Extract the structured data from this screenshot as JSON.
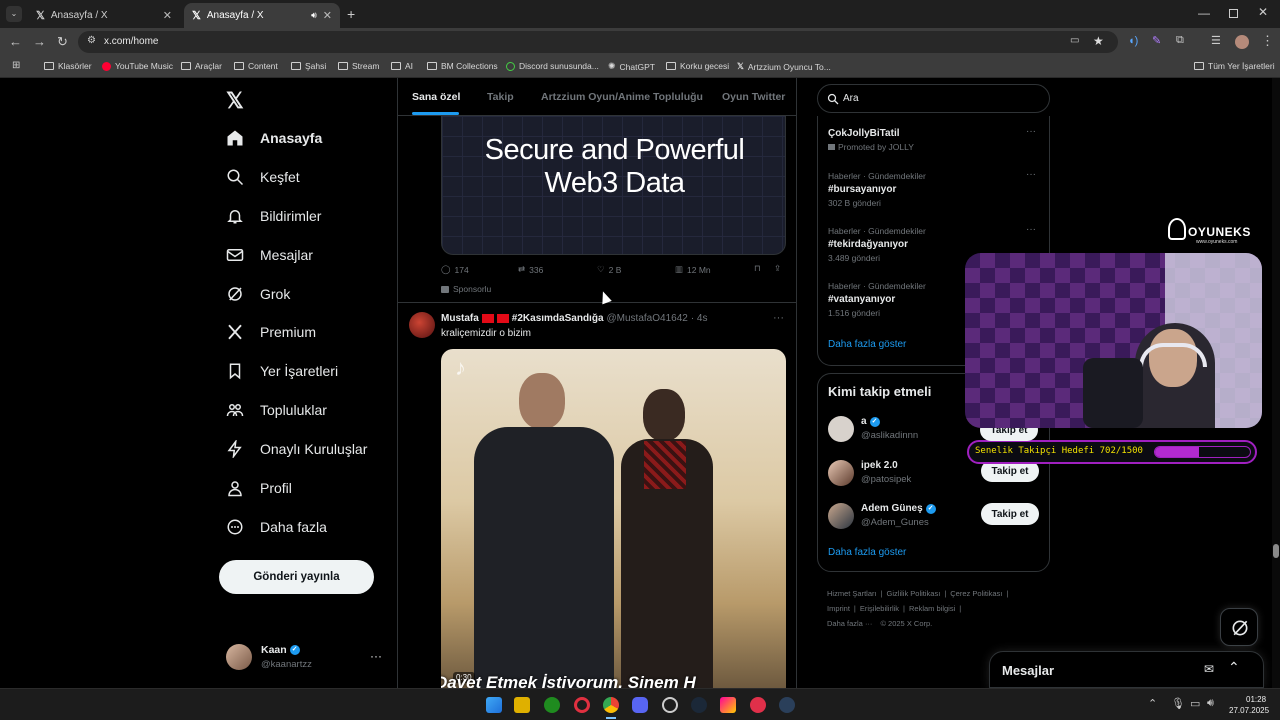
{
  "browser": {
    "tabs": [
      {
        "title": "Anasayfa / X"
      },
      {
        "title": "Anasayfa / X"
      }
    ],
    "url": "x.com/home",
    "bookmarks": [
      "Klasörler",
      "YouTube Music",
      "Araçlar",
      "Content",
      "Şahsi",
      "Stream",
      "AI",
      "BM Collections",
      "Discord sunusunda...",
      "ChatGPT",
      "Korku gecesi",
      "Artzzium Oyuncu To...",
      "Tüm Yer İşaretleri"
    ]
  },
  "sidebar": {
    "items": [
      {
        "label": "Anasayfa"
      },
      {
        "label": "Keşfet"
      },
      {
        "label": "Bildirimler"
      },
      {
        "label": "Mesajlar"
      },
      {
        "label": "Grok"
      },
      {
        "label": "Premium"
      },
      {
        "label": "Yer İşaretleri"
      },
      {
        "label": "Topluluklar"
      },
      {
        "label": "Onaylı Kuruluşlar"
      },
      {
        "label": "Profil"
      },
      {
        "label": "Daha fazla"
      }
    ],
    "post_button": "Gönderi yayınla",
    "account": {
      "name": "Kaan",
      "handle": "@kaanartzz"
    }
  },
  "feed": {
    "tabs": [
      "Sana özel",
      "Takip",
      "Artzzium Oyun/Anime Topluluğu",
      "Oyun Twitter"
    ],
    "ad": {
      "headline_line1": "Secure and Powerful",
      "headline_line2": "Web3 Data",
      "replies": "174",
      "reposts": "336",
      "likes": "2 B",
      "views": "12 Mn",
      "sponsored": "Sponsorlu"
    },
    "post": {
      "name": "Mustafa",
      "name_suffix": "#2KasımdaSandığa",
      "handle": "@MustafaO41642",
      "time": "· 4s",
      "text": "kraliçemizdir o bizim",
      "video_time": "0:30",
      "caption": "Davet Etmek İstiyorum, Sinem H"
    }
  },
  "right": {
    "search_placeholder": "Ara",
    "trends": [
      {
        "category": "",
        "name": "ÇokJollyBiTatil",
        "meta": "Promoted by JOLLY"
      },
      {
        "category": "Haberler · Gündemdekiler",
        "name": "#bursayanıyor",
        "meta": "302 B gönderi"
      },
      {
        "category": "Haberler · Gündemdekiler",
        "name": "#tekirdağyanıyor",
        "meta": "3.489 gönderi"
      },
      {
        "category": "Haberler · Gündemdekiler",
        "name": "#vatanyanıyor",
        "meta": "1.516 gönderi"
      }
    ],
    "show_more": "Daha fazla göster",
    "who_to_follow": {
      "title": "Kimi takip etmeli",
      "users": [
        {
          "name": "a",
          "handle": "@aslikadinnn",
          "button": "Takip et"
        },
        {
          "name": "ipek 2.0",
          "handle": "@patosipek",
          "button": "Takip et"
        },
        {
          "name": "Adem Güneş",
          "handle": "@Adem_Gunes",
          "button": "Takip et"
        }
      ],
      "show_more": "Daha fazla göster"
    },
    "footer": [
      "Hizmet Şartları",
      "Gizlilik Politikası",
      "Çerez Politikası",
      "Imprint",
      "Erişilebilirlik",
      "Reklam bilgisi",
      "Daha fazla ···",
      "© 2025 X Corp."
    ],
    "messages_title": "Mesajlar"
  },
  "overlay": {
    "brand": "OYUNEKS",
    "brand_url": "www.oyuneks.com",
    "goal_text": "Senelik Takipçi Hedefi 702/1500",
    "goal_progress": 0.468
  },
  "taskbar": {
    "time": "01:28",
    "date": "27.07.2025"
  },
  "colors": {
    "accent": "#1d9bf0",
    "overlay_purple": "#a020c0"
  }
}
